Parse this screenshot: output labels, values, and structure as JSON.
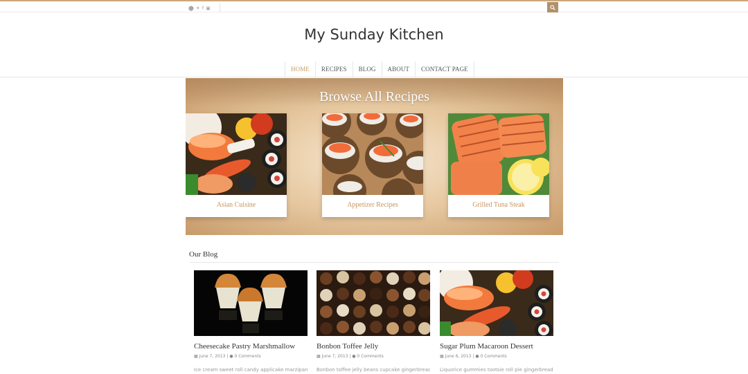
{
  "header": {
    "social_icons": [
      "pinterest-icon",
      "twitter-icon",
      "facebook-icon",
      "instagram-icon"
    ],
    "site_title": "My Sunday Kitchen",
    "accent_color": "#c9a77c"
  },
  "nav": {
    "items": [
      {
        "label": "HOME"
      },
      {
        "label": "RECIPES"
      },
      {
        "label": "BLOG"
      },
      {
        "label": "ABOUT"
      },
      {
        "label": "CONTACT PAGE"
      }
    ]
  },
  "banner": {
    "title": "Browse All Recipes",
    "cards": [
      {
        "label": "Asian Cuisine"
      },
      {
        "label": "Appetizer Recipes"
      },
      {
        "label": "Grilled Tuna Steak"
      }
    ]
  },
  "blog": {
    "heading": "Our Blog",
    "posts": [
      {
        "title": "Cheesecake Pastry Marshmallow",
        "date": "June 7, 2013",
        "comments": "0 Comments",
        "excerpt": "Ice cream sweet roll candy applicake marzipan"
      },
      {
        "title": "Bonbon Toffee Jelly",
        "date": "June 7, 2013",
        "comments": "0 Comments",
        "excerpt": "Bonbon toffee jelly beans cupcake gingerbread"
      },
      {
        "title": "Sugar Plum Macaroon Dessert",
        "date": "June 6, 2013",
        "comments": "0 Comments",
        "excerpt": "Liquorice gummies tootsie roll pie gingerbread"
      }
    ]
  }
}
